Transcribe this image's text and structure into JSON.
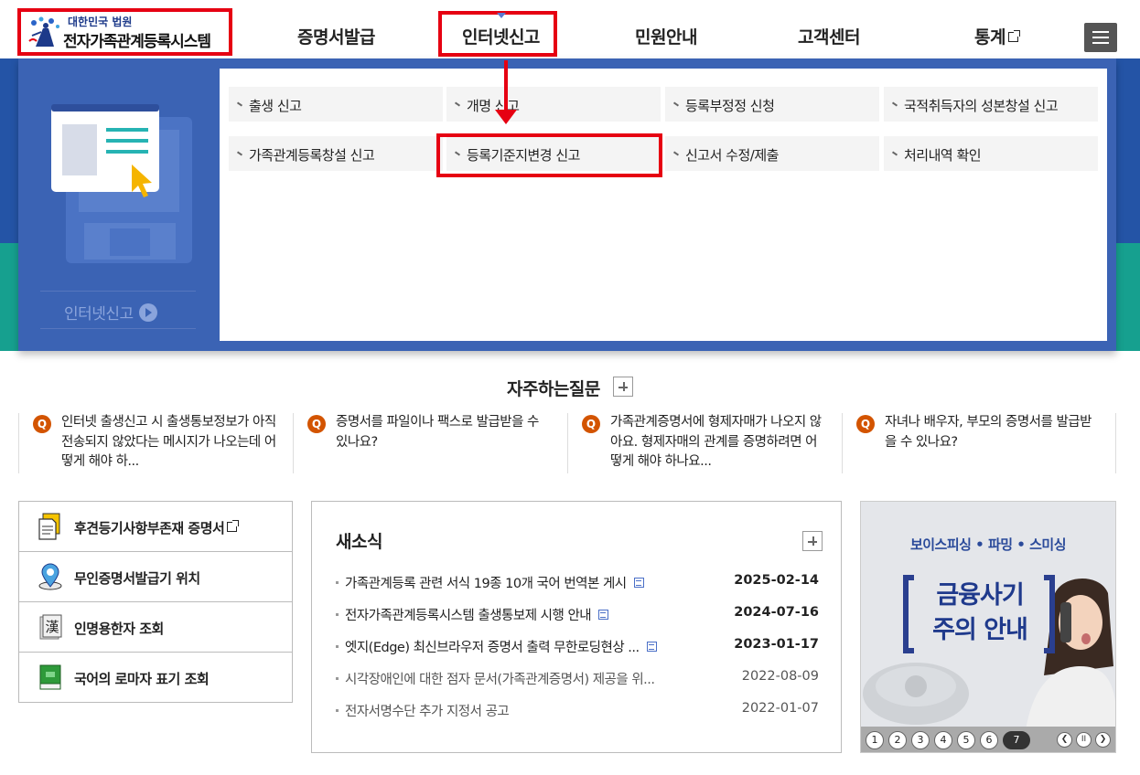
{
  "header": {
    "logo_line1": "대한민국 법원",
    "logo_line2": "전자가족관계등록시스템",
    "nav": [
      {
        "label": "증명서발급"
      },
      {
        "label": "인터넷신고"
      },
      {
        "label": "민원안내"
      },
      {
        "label": "고객센터"
      },
      {
        "label": "통계"
      }
    ]
  },
  "mega_menu": {
    "section_label": "인터넷신고",
    "items": [
      {
        "label": "출생 신고"
      },
      {
        "label": "개명 신고"
      },
      {
        "label": "등록부정정 신청"
      },
      {
        "label": "국적취득자의 성본창설 신고"
      },
      {
        "label": "가족관계등록창설 신고"
      },
      {
        "label": "등록기준지변경 신고"
      },
      {
        "label": "신고서 수정/제출"
      },
      {
        "label": "처리내역 확인"
      }
    ],
    "highlighted_item": "등록기준지변경 신고"
  },
  "faq": {
    "title": "자주하는질문",
    "q_badge": "Q",
    "items": [
      {
        "text": "인터넷 출생신고 시 출생통보정보가 아직 전송되지 않았다는 메시지가 나오는데 어떻게 해야 하..."
      },
      {
        "text": "증명서를 파일이나 팩스로 발급받을 수 있나요?"
      },
      {
        "text": "가족관계증명서에 형제자매가 나오지 않아요. 형제자매의 관계를 증명하려면 어떻게 해야 하나요..."
      },
      {
        "text": "자녀나 배우자, 부모의 증명서를 발급받을 수 있나요?"
      }
    ]
  },
  "quick_links": [
    {
      "label": "후견등기사항부존재 증명서",
      "icon": "document-icon"
    },
    {
      "label": "무인증명서발급기 위치",
      "icon": "location-pin-icon"
    },
    {
      "label": "인명용한자 조회",
      "icon": "hanja-book-icon"
    },
    {
      "label": "국어의 로마자 표기 조회",
      "icon": "green-book-icon"
    }
  ],
  "news": {
    "title": "새소식",
    "items": [
      {
        "title": "가족관계등록 관련 서식 19종 10개 국어 번역본 게시",
        "date": "2025-02-14",
        "new": true
      },
      {
        "title": "전자가족관계등록시스템 출생통보제 시행 안내",
        "date": "2024-07-16",
        "new": true
      },
      {
        "title": "엣지(Edge) 최신브라우저 증명서 출력 무한로딩현상 ...",
        "date": "2023-01-17",
        "new": true
      },
      {
        "title": "시각장애인에 대한 점자 문서(가족관계증명서) 제공을 위...",
        "date": "2022-08-09",
        "new": false
      },
      {
        "title": "전자서명수단 추가 지정서 공고",
        "date": "2022-01-07",
        "new": false
      }
    ]
  },
  "banner": {
    "subtitle": "보이스피싱 • 파밍 • 스미싱",
    "headline_1": "금융사기",
    "headline_2": "주의 안내",
    "pages": [
      "1",
      "2",
      "3",
      "4",
      "5",
      "6",
      "7"
    ],
    "current_page": "7",
    "pause_symbol": "II"
  },
  "colors": {
    "brand_blue": "#2454a6",
    "teal": "#16a08f",
    "annotation_red": "#e60012",
    "faq_badge": "#d35400"
  }
}
